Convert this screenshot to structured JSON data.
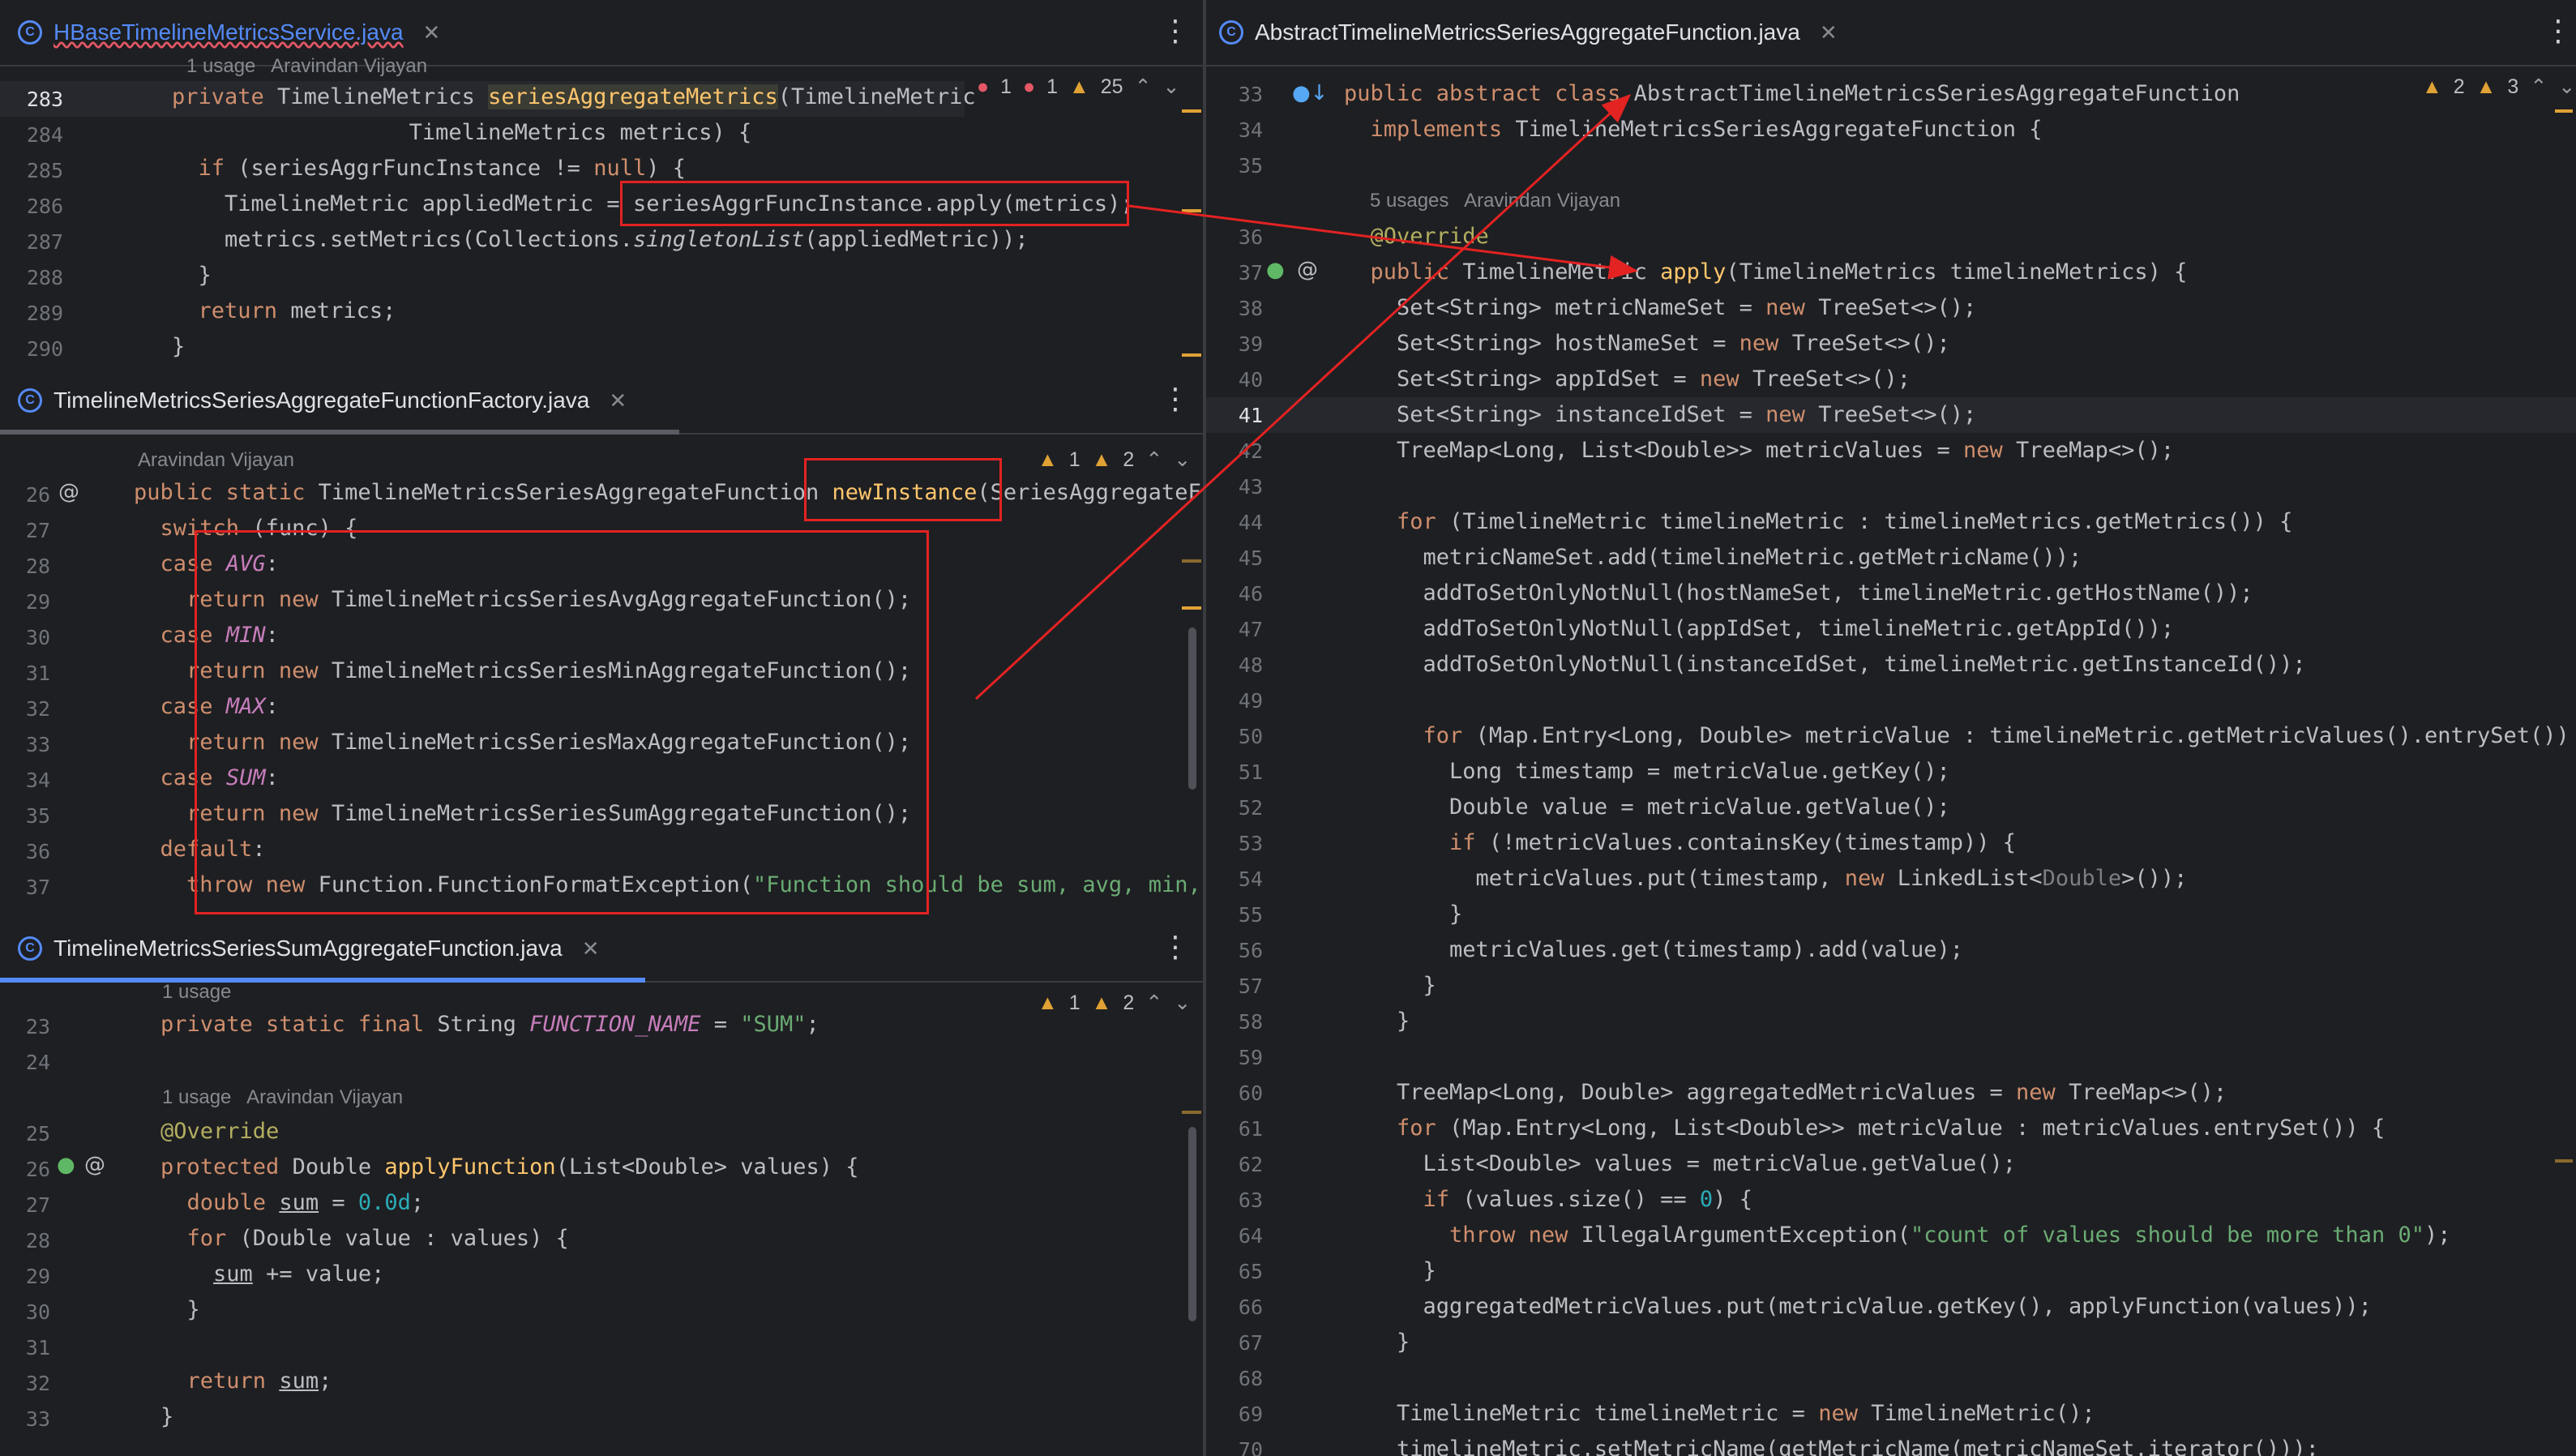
{
  "panes": {
    "top_left": {
      "tab_title": "HBaseTimelineMetricsService.java",
      "hint": "1 usage   Aravindan Vijayan",
      "indicators": {
        "errors1": "1",
        "errors2": "1",
        "warnings": "25"
      },
      "lines": [
        "283",
        "284",
        "285",
        "286",
        "287",
        "288",
        "289",
        "290"
      ]
    },
    "mid_left": {
      "tab_title": "TimelineMetricsSeriesAggregateFunctionFactory.java",
      "hint": "Aravindan Vijayan",
      "indicators": {
        "warnings": "1",
        "weak": "2"
      },
      "lines": [
        "26",
        "27",
        "28",
        "29",
        "30",
        "31",
        "32",
        "33",
        "34",
        "35",
        "36",
        "37"
      ]
    },
    "bottom_left": {
      "tab_title": "TimelineMetricsSeriesSumAggregateFunction.java",
      "hint1": "1 usage",
      "hint2": "1 usage   Aravindan Vijayan",
      "indicators": {
        "warnings": "1",
        "weak": "2"
      },
      "lines": [
        "23",
        "24",
        "25",
        "26",
        "27",
        "28",
        "29",
        "30",
        "31",
        "32",
        "33"
      ]
    },
    "right": {
      "tab_title": "AbstractTimelineMetricsSeriesAggregateFunction.java",
      "hint": "5 usages   Aravindan Vijayan",
      "indicators": {
        "warnings": "2",
        "weak": "3"
      },
      "lines": [
        "33",
        "34",
        "35",
        "36",
        "37",
        "38",
        "39",
        "40",
        "41",
        "42",
        "43",
        "44",
        "45",
        "46",
        "47",
        "48",
        "49",
        "50",
        "51",
        "52",
        "53",
        "54",
        "55",
        "56",
        "57",
        "58",
        "59",
        "60",
        "61",
        "62",
        "63",
        "64",
        "65",
        "66",
        "67",
        "68",
        "69",
        "70"
      ]
    }
  },
  "icons": [
    "class-file-icon",
    "close-icon",
    "kebab-menu-icon",
    "warning-icon",
    "error-icon",
    "chevron-up-icon",
    "chevron-down-icon",
    "implements-icon",
    "override-icon",
    "user-icon"
  ],
  "colors": {
    "annotation_red": "#e32222",
    "accent_blue": "#548af7",
    "keyword": "#cf8e6d"
  }
}
